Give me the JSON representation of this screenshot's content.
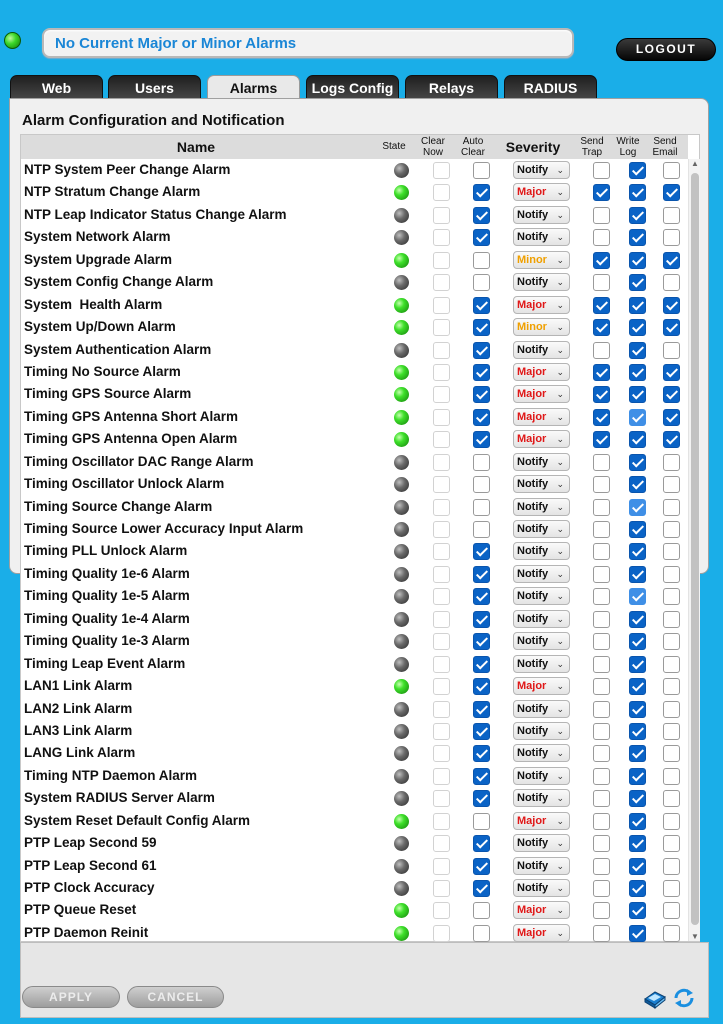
{
  "header": {
    "status_message": "No Current Major or Minor Alarms",
    "logout_label": "LOGOUT"
  },
  "tabs": [
    "Web",
    "Users",
    "Alarms",
    "Logs Config",
    "Relays",
    "RADIUS"
  ],
  "active_tab": "Alarms",
  "panel": {
    "title": "Alarm Configuration and Notification",
    "columns": {
      "name": "Name",
      "state": "State",
      "clear_now": [
        "Clear",
        "Now"
      ],
      "auto_clear": [
        "Auto",
        "Clear"
      ],
      "severity": "Severity",
      "send_trap": [
        "Send",
        "Trap"
      ],
      "write_log": [
        "Write",
        "Log"
      ],
      "send_email": [
        "Send",
        "Email"
      ]
    }
  },
  "severity_colors": {
    "Notify": "#111111",
    "Major": "#e01818",
    "Minor": "#f0a000"
  },
  "alarms": [
    {
      "name": "NTP System Peer Change Alarm",
      "state": "off",
      "auto_clear": false,
      "severity": "Notify",
      "send_trap": false,
      "write_log": true,
      "send_email": false
    },
    {
      "name": "NTP Stratum Change Alarm",
      "state": "on",
      "auto_clear": true,
      "severity": "Major",
      "send_trap": true,
      "write_log": true,
      "send_email": true
    },
    {
      "name": "NTP Leap Indicator Status Change Alarm",
      "state": "off",
      "auto_clear": true,
      "severity": "Notify",
      "send_trap": false,
      "write_log": true,
      "send_email": false
    },
    {
      "name": "System Network Alarm",
      "state": "off",
      "auto_clear": true,
      "severity": "Notify",
      "send_trap": false,
      "write_log": true,
      "send_email": false
    },
    {
      "name": "System Upgrade Alarm",
      "state": "on",
      "auto_clear": false,
      "severity": "Minor",
      "send_trap": true,
      "write_log": true,
      "send_email": true
    },
    {
      "name": "System Config Change Alarm",
      "state": "off",
      "auto_clear": false,
      "severity": "Notify",
      "send_trap": false,
      "write_log": true,
      "send_email": false
    },
    {
      "name": "System  Health Alarm",
      "state": "on",
      "auto_clear": true,
      "severity": "Major",
      "send_trap": true,
      "write_log": true,
      "send_email": true
    },
    {
      "name": "System Up/Down Alarm",
      "state": "on",
      "auto_clear": true,
      "severity": "Minor",
      "send_trap": true,
      "write_log": true,
      "send_email": true
    },
    {
      "name": "System Authentication Alarm",
      "state": "off",
      "auto_clear": true,
      "severity": "Notify",
      "send_trap": false,
      "write_log": true,
      "send_email": false
    },
    {
      "name": "Timing No Source Alarm",
      "state": "on",
      "auto_clear": true,
      "severity": "Major",
      "send_trap": true,
      "write_log": true,
      "send_email": true
    },
    {
      "name": "Timing GPS Source Alarm",
      "state": "on",
      "auto_clear": true,
      "severity": "Major",
      "send_trap": true,
      "write_log": true,
      "send_email": true
    },
    {
      "name": "Timing GPS Antenna Short Alarm",
      "state": "on",
      "auto_clear": true,
      "severity": "Major",
      "send_trap": true,
      "write_log": true,
      "send_email": true
    },
    {
      "name": "Timing GPS Antenna Open Alarm",
      "state": "on",
      "auto_clear": true,
      "severity": "Major",
      "send_trap": true,
      "write_log": true,
      "send_email": true
    },
    {
      "name": "Timing Oscillator DAC Range Alarm",
      "state": "off",
      "auto_clear": false,
      "severity": "Notify",
      "send_trap": false,
      "write_log": true,
      "send_email": false
    },
    {
      "name": "Timing Oscillator Unlock Alarm",
      "state": "off",
      "auto_clear": false,
      "severity": "Notify",
      "send_trap": false,
      "write_log": true,
      "send_email": false
    },
    {
      "name": "Timing Source Change Alarm",
      "state": "off",
      "auto_clear": false,
      "severity": "Notify",
      "send_trap": false,
      "write_log": true,
      "send_email": false
    },
    {
      "name": "Timing Source Lower Accuracy Input Alarm",
      "state": "off",
      "auto_clear": false,
      "severity": "Notify",
      "send_trap": false,
      "write_log": true,
      "send_email": false
    },
    {
      "name": "Timing PLL Unlock Alarm",
      "state": "off",
      "auto_clear": true,
      "severity": "Notify",
      "send_trap": false,
      "write_log": true,
      "send_email": false
    },
    {
      "name": "Timing Quality 1e-6 Alarm",
      "state": "off",
      "auto_clear": true,
      "severity": "Notify",
      "send_trap": false,
      "write_log": true,
      "send_email": false
    },
    {
      "name": "Timing Quality 1e-5 Alarm",
      "state": "off",
      "auto_clear": true,
      "severity": "Notify",
      "send_trap": false,
      "write_log": true,
      "send_email": false
    },
    {
      "name": "Timing Quality 1e-4 Alarm",
      "state": "off",
      "auto_clear": true,
      "severity": "Notify",
      "send_trap": false,
      "write_log": true,
      "send_email": false
    },
    {
      "name": "Timing Quality 1e-3 Alarm",
      "state": "off",
      "auto_clear": true,
      "severity": "Notify",
      "send_trap": false,
      "write_log": true,
      "send_email": false
    },
    {
      "name": "Timing Leap Event Alarm",
      "state": "off",
      "auto_clear": true,
      "severity": "Notify",
      "send_trap": false,
      "write_log": true,
      "send_email": false
    },
    {
      "name": "LAN1 Link Alarm",
      "state": "on",
      "auto_clear": true,
      "severity": "Major",
      "send_trap": false,
      "write_log": true,
      "send_email": false
    },
    {
      "name": "LAN2 Link Alarm",
      "state": "off",
      "auto_clear": true,
      "severity": "Notify",
      "send_trap": false,
      "write_log": true,
      "send_email": false
    },
    {
      "name": "LAN3 Link Alarm",
      "state": "off",
      "auto_clear": true,
      "severity": "Notify",
      "send_trap": false,
      "write_log": true,
      "send_email": false
    },
    {
      "name": "LANG Link Alarm",
      "state": "off",
      "auto_clear": true,
      "severity": "Notify",
      "send_trap": false,
      "write_log": true,
      "send_email": false
    },
    {
      "name": "Timing NTP Daemon Alarm",
      "state": "off",
      "auto_clear": true,
      "severity": "Notify",
      "send_trap": false,
      "write_log": true,
      "send_email": false
    },
    {
      "name": "System RADIUS Server Alarm",
      "state": "off",
      "auto_clear": true,
      "severity": "Notify",
      "send_trap": false,
      "write_log": true,
      "send_email": false
    },
    {
      "name": "System Reset Default Config Alarm",
      "state": "on",
      "auto_clear": false,
      "severity": "Major",
      "send_trap": false,
      "write_log": true,
      "send_email": false
    },
    {
      "name": "PTP Leap Second 59",
      "state": "off",
      "auto_clear": true,
      "severity": "Notify",
      "send_trap": false,
      "write_log": true,
      "send_email": false
    },
    {
      "name": "PTP Leap Second 61",
      "state": "off",
      "auto_clear": true,
      "severity": "Notify",
      "send_trap": false,
      "write_log": true,
      "send_email": false
    },
    {
      "name": "PTP Clock Accuracy",
      "state": "off",
      "auto_clear": true,
      "severity": "Notify",
      "send_trap": false,
      "write_log": true,
      "send_email": false
    },
    {
      "name": "PTP Queue Reset",
      "state": "on",
      "auto_clear": false,
      "severity": "Major",
      "send_trap": false,
      "write_log": true,
      "send_email": false
    },
    {
      "name": "PTP Daemon Reinit",
      "state": "on",
      "auto_clear": false,
      "severity": "Major",
      "send_trap": false,
      "write_log": true,
      "send_email": false
    }
  ],
  "footer": {
    "apply_label": "APPLY",
    "cancel_label": "CANCEL"
  },
  "icons": {
    "help": "help-book-icon",
    "refresh": "refresh-icon"
  }
}
